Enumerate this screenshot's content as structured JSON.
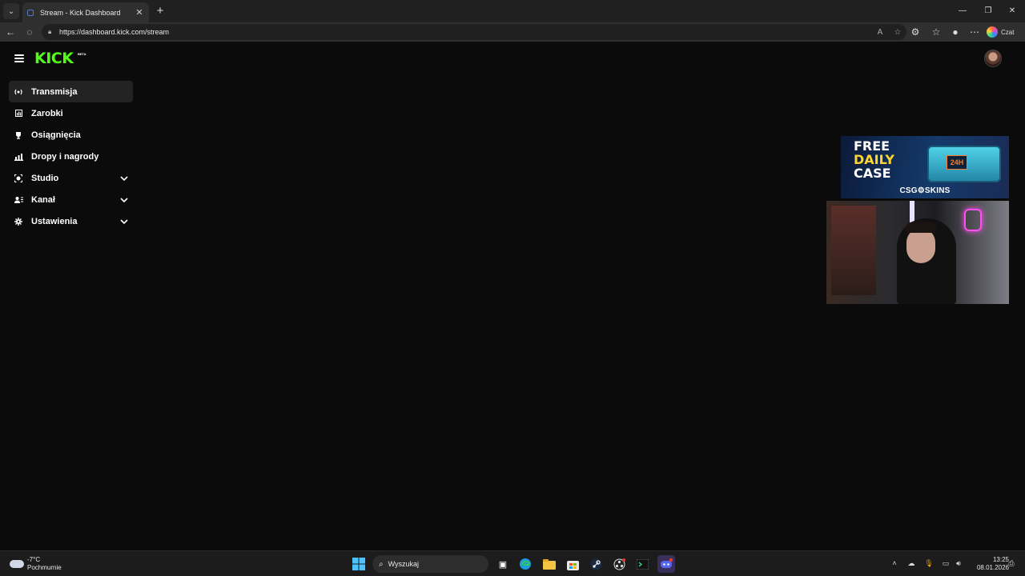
{
  "browser": {
    "tab_title": "Stream - Kick Dashboard",
    "url": "https://dashboard.kick.com/stream",
    "copilot_label": "Czat"
  },
  "header": {
    "logo_text": "KICK",
    "logo_badge": "BETA"
  },
  "sidebar": {
    "items": [
      {
        "label": "Transmisja",
        "icon": "broadcast-icon",
        "active": true,
        "expandable": false
      },
      {
        "label": "Zarobki",
        "icon": "earnings-icon",
        "active": false,
        "expandable": false
      },
      {
        "label": "Osiągnięcia",
        "icon": "trophy-icon",
        "active": false,
        "expandable": false
      },
      {
        "label": "Dropy i nagrody",
        "icon": "drops-icon",
        "active": false,
        "expandable": false
      },
      {
        "label": "Studio",
        "icon": "studio-icon",
        "active": false,
        "expandable": true
      },
      {
        "label": "Kanał",
        "icon": "channel-icon",
        "active": false,
        "expandable": true
      },
      {
        "label": "Ustawienia",
        "icon": "gear-icon",
        "active": false,
        "expandable": true
      }
    ]
  },
  "ad": {
    "line1": "FREE",
    "line2": "DAILY",
    "line3": "CASE",
    "badge": "24H",
    "brand": "CSG⚙SKINS"
  },
  "taskbar": {
    "weather_temp": "-7°C",
    "weather_desc": "Pochmurnie",
    "search_placeholder": "Wyszukaj",
    "time": "13:25",
    "date": "08.01.2026"
  }
}
